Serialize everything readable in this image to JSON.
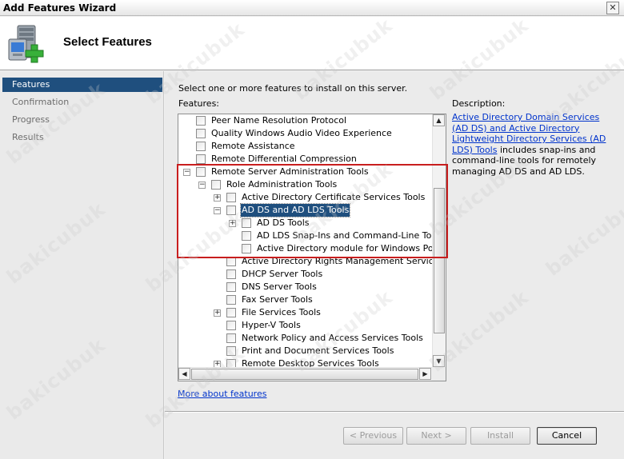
{
  "window": {
    "title": "Add Features Wizard",
    "close_glyph": "✕"
  },
  "header": {
    "page_title": "Select Features"
  },
  "nav": {
    "items": [
      {
        "label": "Features"
      },
      {
        "label": "Confirmation"
      },
      {
        "label": "Progress"
      },
      {
        "label": "Results"
      }
    ]
  },
  "main": {
    "instruction": "Select one or more features to install on this server.",
    "features_label": "Features:",
    "description_label": "Description:",
    "description_link": "Active Directory Domain Services (AD DS) and Active Directory Lightweight Directory Services (AD LDS) Tools",
    "description_text": "includes snap-ins and command-line tools for remotely managing AD DS and AD LDS.",
    "more_link": "More about features"
  },
  "tree": [
    {
      "label": "Peer Name Resolution Protocol"
    },
    {
      "label": "Quality Windows Audio Video Experience"
    },
    {
      "label": "Remote Assistance"
    },
    {
      "label": "Remote Differential Compression"
    },
    {
      "label": "Remote Server Administration Tools",
      "expander": "−"
    },
    {
      "label": "Role Administration Tools",
      "expander": "−"
    },
    {
      "label": "Active Directory Certificate Services Tools",
      "expander": "+"
    },
    {
      "label": "AD DS and AD LDS Tools",
      "expander": "−"
    },
    {
      "label": "AD DS Tools",
      "expander": "+"
    },
    {
      "label": "AD LDS Snap-Ins and Command-Line Tools"
    },
    {
      "label": "Active Directory module for Windows PowerShell"
    },
    {
      "label": "Active Directory Rights Management Services Tools"
    },
    {
      "label": "DHCP Server Tools"
    },
    {
      "label": "DNS Server Tools"
    },
    {
      "label": "Fax Server Tools"
    },
    {
      "label": "File Services Tools",
      "expander": "+"
    },
    {
      "label": "Hyper-V Tools"
    },
    {
      "label": "Network Policy and Access Services Tools"
    },
    {
      "label": "Print and Document Services Tools"
    },
    {
      "label": "Remote Desktop Services Tools",
      "expander": "+"
    }
  ],
  "scroll_glyphs": {
    "up": "▲",
    "down": "▼",
    "left": "◀",
    "right": "▶"
  },
  "buttons": {
    "previous": "< Previous",
    "next": "Next >",
    "install": "Install",
    "cancel": "Cancel"
  },
  "watermark": "bakicubuk"
}
